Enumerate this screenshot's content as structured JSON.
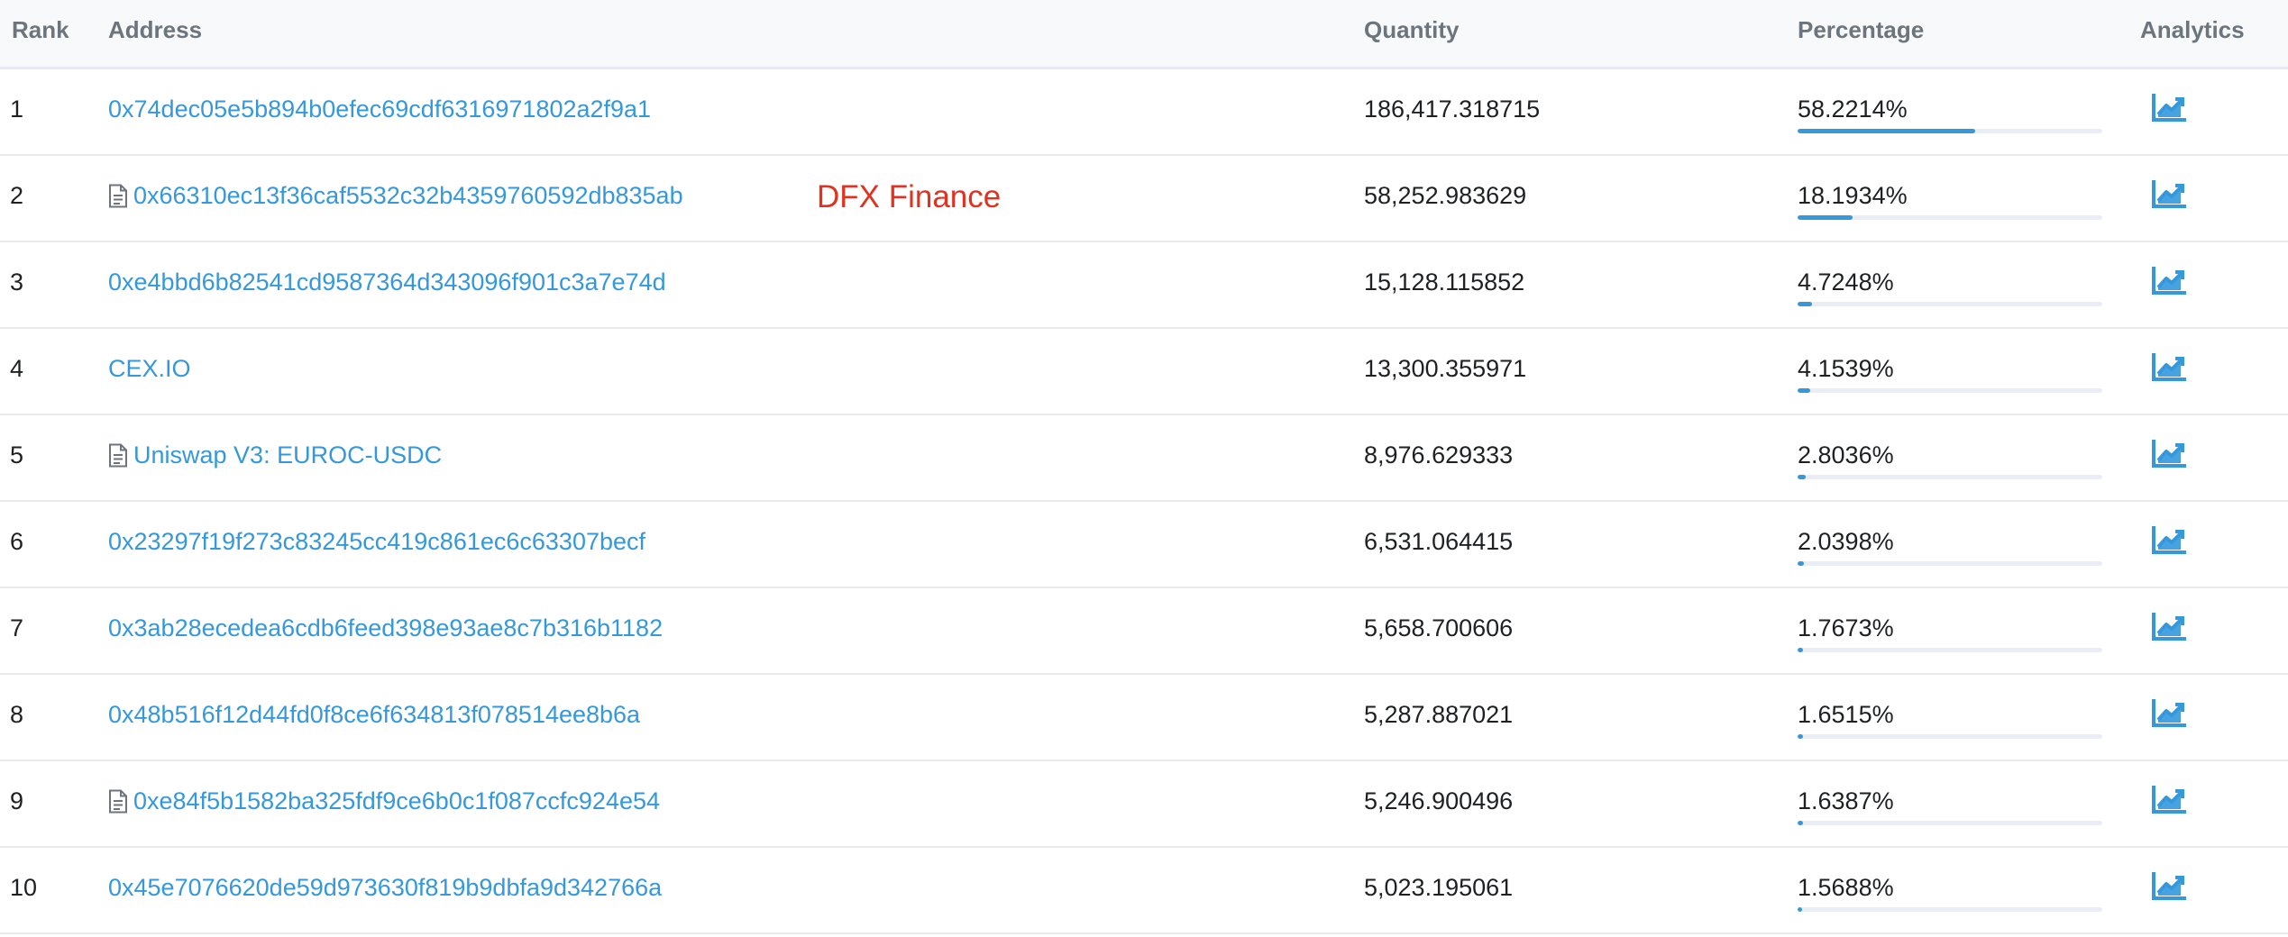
{
  "header": {
    "rank": "Rank",
    "address": "Address",
    "quantity": "Quantity",
    "percentage": "Percentage",
    "analytics": "Analytics"
  },
  "annotation": "DFX Finance",
  "colors": {
    "link": "#3498db",
    "annotation": "#e0321e",
    "bar": "#3498db",
    "bar_track": "#eaedf5",
    "header_bg": "#f8f9fa"
  },
  "rows": [
    {
      "rank": "1",
      "address": "0x74dec05e5b894b0efec69cdf6316971802a2f9a1",
      "is_contract": false,
      "quantity": "186,417.318715",
      "percentage": "58.2214%",
      "pct_value": 58.2214
    },
    {
      "rank": "2",
      "address": "0x66310ec13f36caf5532c32b4359760592db835ab",
      "is_contract": true,
      "quantity": "58,252.983629",
      "percentage": "18.1934%",
      "pct_value": 18.1934
    },
    {
      "rank": "3",
      "address": "0xe4bbd6b82541cd9587364d343096f901c3a7e74d",
      "is_contract": false,
      "quantity": "15,128.115852",
      "percentage": "4.7248%",
      "pct_value": 4.7248
    },
    {
      "rank": "4",
      "address": "CEX.IO",
      "is_contract": false,
      "quantity": "13,300.355971",
      "percentage": "4.1539%",
      "pct_value": 4.1539
    },
    {
      "rank": "5",
      "address": "Uniswap V3: EUROC-USDC",
      "is_contract": true,
      "quantity": "8,976.629333",
      "percentage": "2.8036%",
      "pct_value": 2.8036
    },
    {
      "rank": "6",
      "address": "0x23297f19f273c83245cc419c861ec6c63307becf",
      "is_contract": false,
      "quantity": "6,531.064415",
      "percentage": "2.0398%",
      "pct_value": 2.0398
    },
    {
      "rank": "7",
      "address": "0x3ab28ecedea6cdb6feed398e93ae8c7b316b1182",
      "is_contract": false,
      "quantity": "5,658.700606",
      "percentage": "1.7673%",
      "pct_value": 1.7673
    },
    {
      "rank": "8",
      "address": "0x48b516f12d44fd0f8ce6f634813f078514ee8b6a",
      "is_contract": false,
      "quantity": "5,287.887021",
      "percentage": "1.6515%",
      "pct_value": 1.6515
    },
    {
      "rank": "9",
      "address": "0xe84f5b1582ba325fdf9ce6b0c1f087ccfc924e54",
      "is_contract": true,
      "quantity": "5,246.900496",
      "percentage": "1.6387%",
      "pct_value": 1.6387
    },
    {
      "rank": "10",
      "address": "0x45e7076620de59d973630f819b9dbfa9d342766a",
      "is_contract": false,
      "quantity": "5,023.195061",
      "percentage": "1.5688%",
      "pct_value": 1.5688
    }
  ]
}
